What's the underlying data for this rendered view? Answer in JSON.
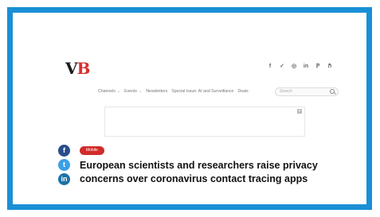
{
  "site": {
    "logo_v": "V",
    "logo_b": "B"
  },
  "social_top": [
    {
      "icon": "facebook-icon",
      "glyph": "f"
    },
    {
      "icon": "twitter-icon",
      "glyph": "✓"
    },
    {
      "icon": "instagram-icon",
      "glyph": "◎"
    },
    {
      "icon": "linkedin-icon",
      "glyph": "in"
    },
    {
      "icon": "flipboard-icon",
      "glyph": "ℙ"
    },
    {
      "icon": "rss-icon",
      "glyph": "ℏ"
    }
  ],
  "nav": {
    "items": [
      {
        "label": "Channels",
        "dropdown": true
      },
      {
        "label": "Events",
        "dropdown": true
      },
      {
        "label": "Newsletters",
        "dropdown": false
      },
      {
        "label": "Special Issue: AI and Surveillance",
        "dropdown": false
      },
      {
        "label": "Deals",
        "dropdown": false
      }
    ],
    "caret": "⌄",
    "search_placeholder": "Search"
  },
  "ad": {
    "close_glyph": "×"
  },
  "share": {
    "facebook": "f",
    "twitter": "t",
    "linkedin": "in"
  },
  "article": {
    "category": "Mobile",
    "title": "European scientists and researchers raise privacy concerns over coronavirus contact tracing apps"
  },
  "colors": {
    "frame": "#1a8fd6",
    "accent": "#d12b2b"
  }
}
